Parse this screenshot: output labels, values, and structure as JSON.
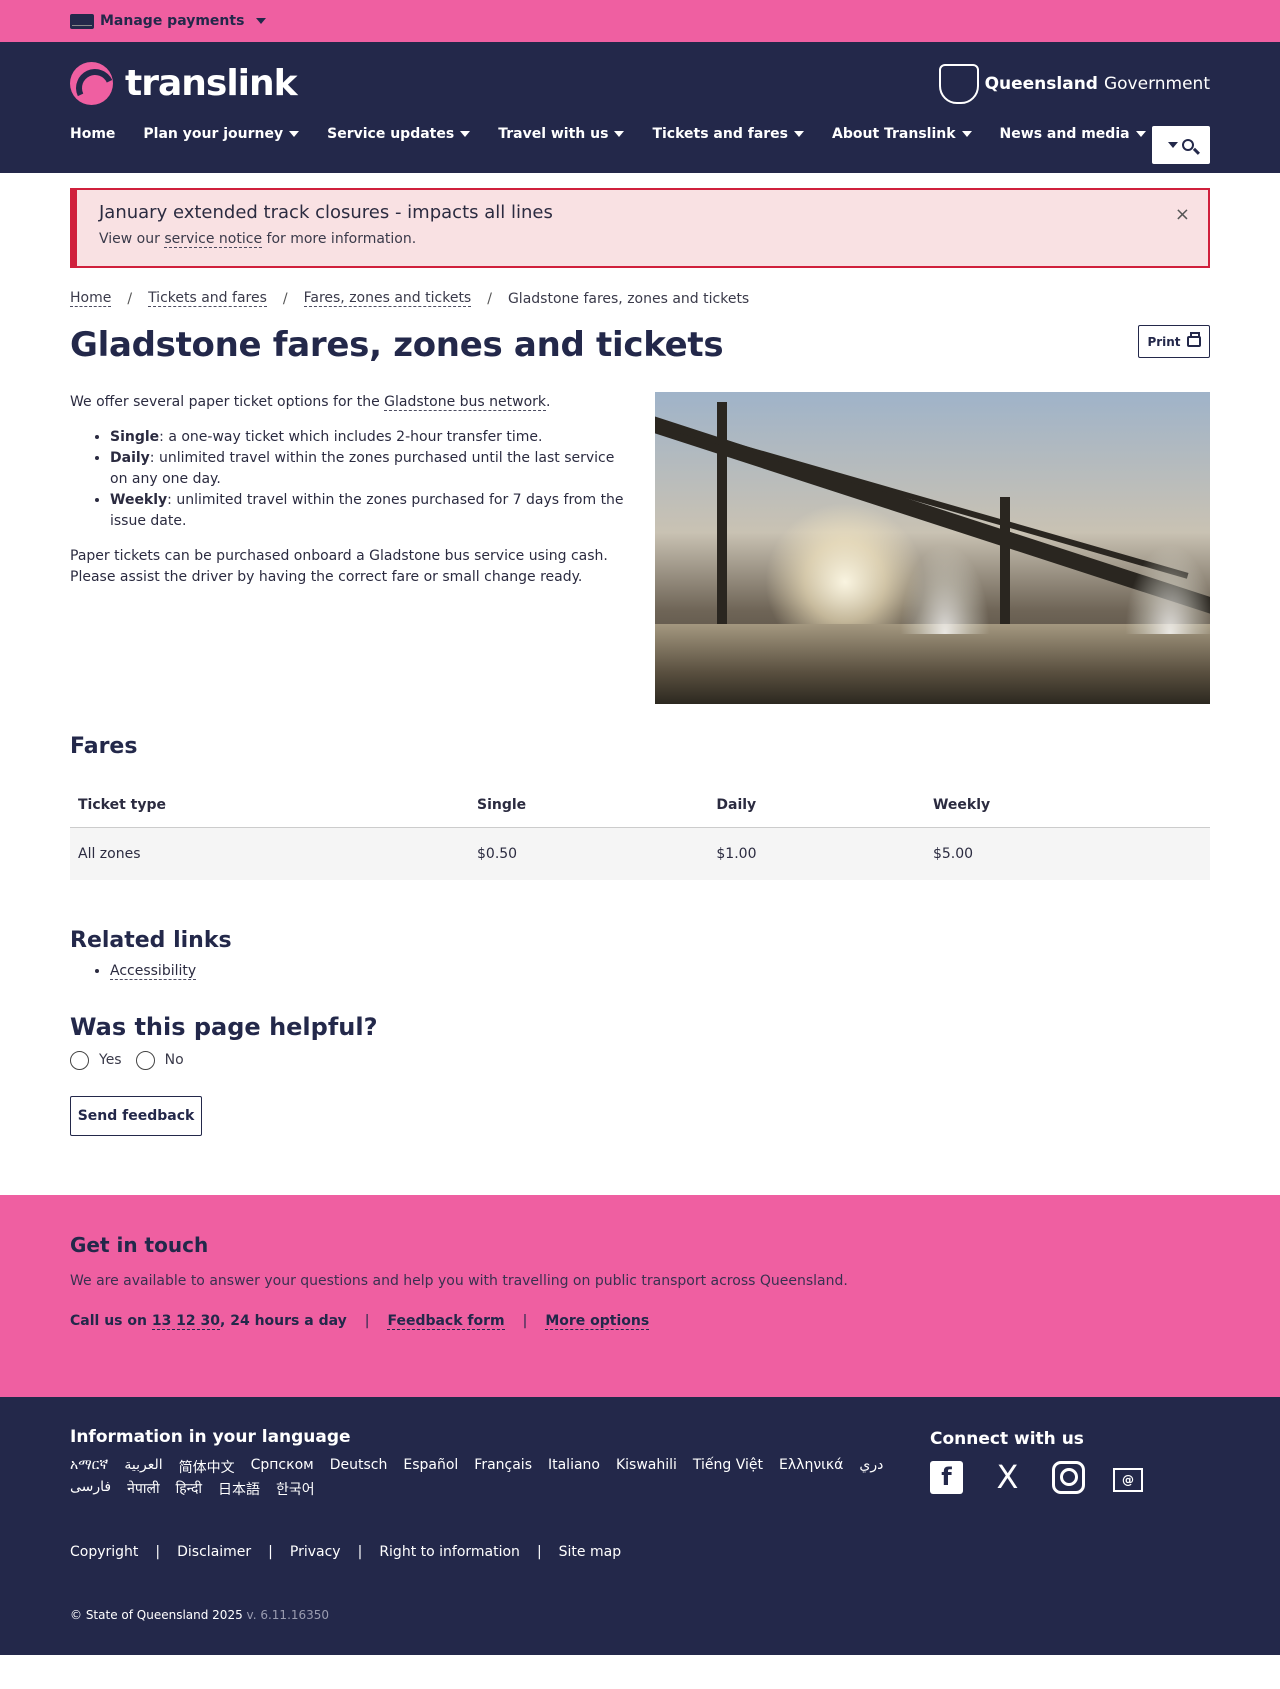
{
  "topbar": {
    "manage_label": "Manage payments"
  },
  "header": {
    "logo_text": "translink",
    "gov_bold": "Queensland",
    "gov_light": "Government",
    "nav": [
      {
        "label": "Home"
      },
      {
        "label": "Plan your journey"
      },
      {
        "label": "Service updates"
      },
      {
        "label": "Travel with us"
      },
      {
        "label": "Tickets and fares"
      },
      {
        "label": "About Translink"
      },
      {
        "label": "News and media"
      }
    ]
  },
  "alert": {
    "title": "January extended track closures - impacts all lines",
    "text_before": "View our",
    "link": "service notice",
    "text_after": "for more information.",
    "close": "×"
  },
  "breadcrumb": {
    "items": [
      "Home",
      "Tickets and fares",
      "Fares, zones and tickets"
    ],
    "current": "Gladstone fares, zones and tickets",
    "separator": "/"
  },
  "page": {
    "title": "Gladstone fares, zones and tickets",
    "print_label": "Print",
    "intro_before": "We offer several paper ticket options for the",
    "intro_link": "Gladstone bus network",
    "intro_after": ".",
    "tickets": [
      {
        "name": "Single",
        "desc": ": a one-way ticket which includes 2-hour transfer time."
      },
      {
        "name": "Daily",
        "desc": ": unlimited travel within the zones purchased until the last service on any one day."
      },
      {
        "name": "Weekly",
        "desc": ": unlimited travel within the zones purchased for 7 days from the issue date."
      }
    ],
    "purchase_note": "Paper tickets can be purchased onboard a Gladstone bus service using cash. Please assist the driver by having the correct fare or small change ready."
  },
  "fares": {
    "heading": "Fares",
    "columns": [
      "Ticket type",
      "Single",
      "Daily",
      "Weekly"
    ],
    "rows": [
      [
        "All zones",
        "$0.50",
        "$1.00",
        "$5.00"
      ]
    ]
  },
  "related": {
    "heading": "Related links",
    "links": [
      "Accessibility"
    ]
  },
  "feedback": {
    "heading": "Was this page helpful?",
    "yes": "Yes",
    "no": "No",
    "send": "Send feedback"
  },
  "touch": {
    "heading": "Get in touch",
    "text": "We are available to answer your questions and help you with travelling on public transport across Queensland.",
    "call_prefix": "Call us on",
    "phone": "13 12 30",
    "call_suffix": ", 24 hours a day",
    "feedback_form": "Feedback form",
    "more_options": "More options",
    "separator": "|"
  },
  "footer": {
    "lang_title": "Information in your language",
    "languages": [
      "አማርኛ",
      "العربية",
      "简体中文",
      "Српском",
      "Deutsch",
      "Español",
      "Français",
      "Italiano",
      "Kiswahili",
      "Tiếng Việt",
      "Ελληνικά",
      "دري",
      "فارسی",
      "नेपाली",
      "हिन्दी",
      "日本語",
      "한국어"
    ],
    "connect_title": "Connect with us",
    "legal": [
      "Copyright",
      "Disclaimer",
      "Privacy",
      "Right to information",
      "Site map"
    ],
    "separator": "|",
    "copyright": "© State of Queensland 2025",
    "version": "v. 6.11.16350"
  }
}
